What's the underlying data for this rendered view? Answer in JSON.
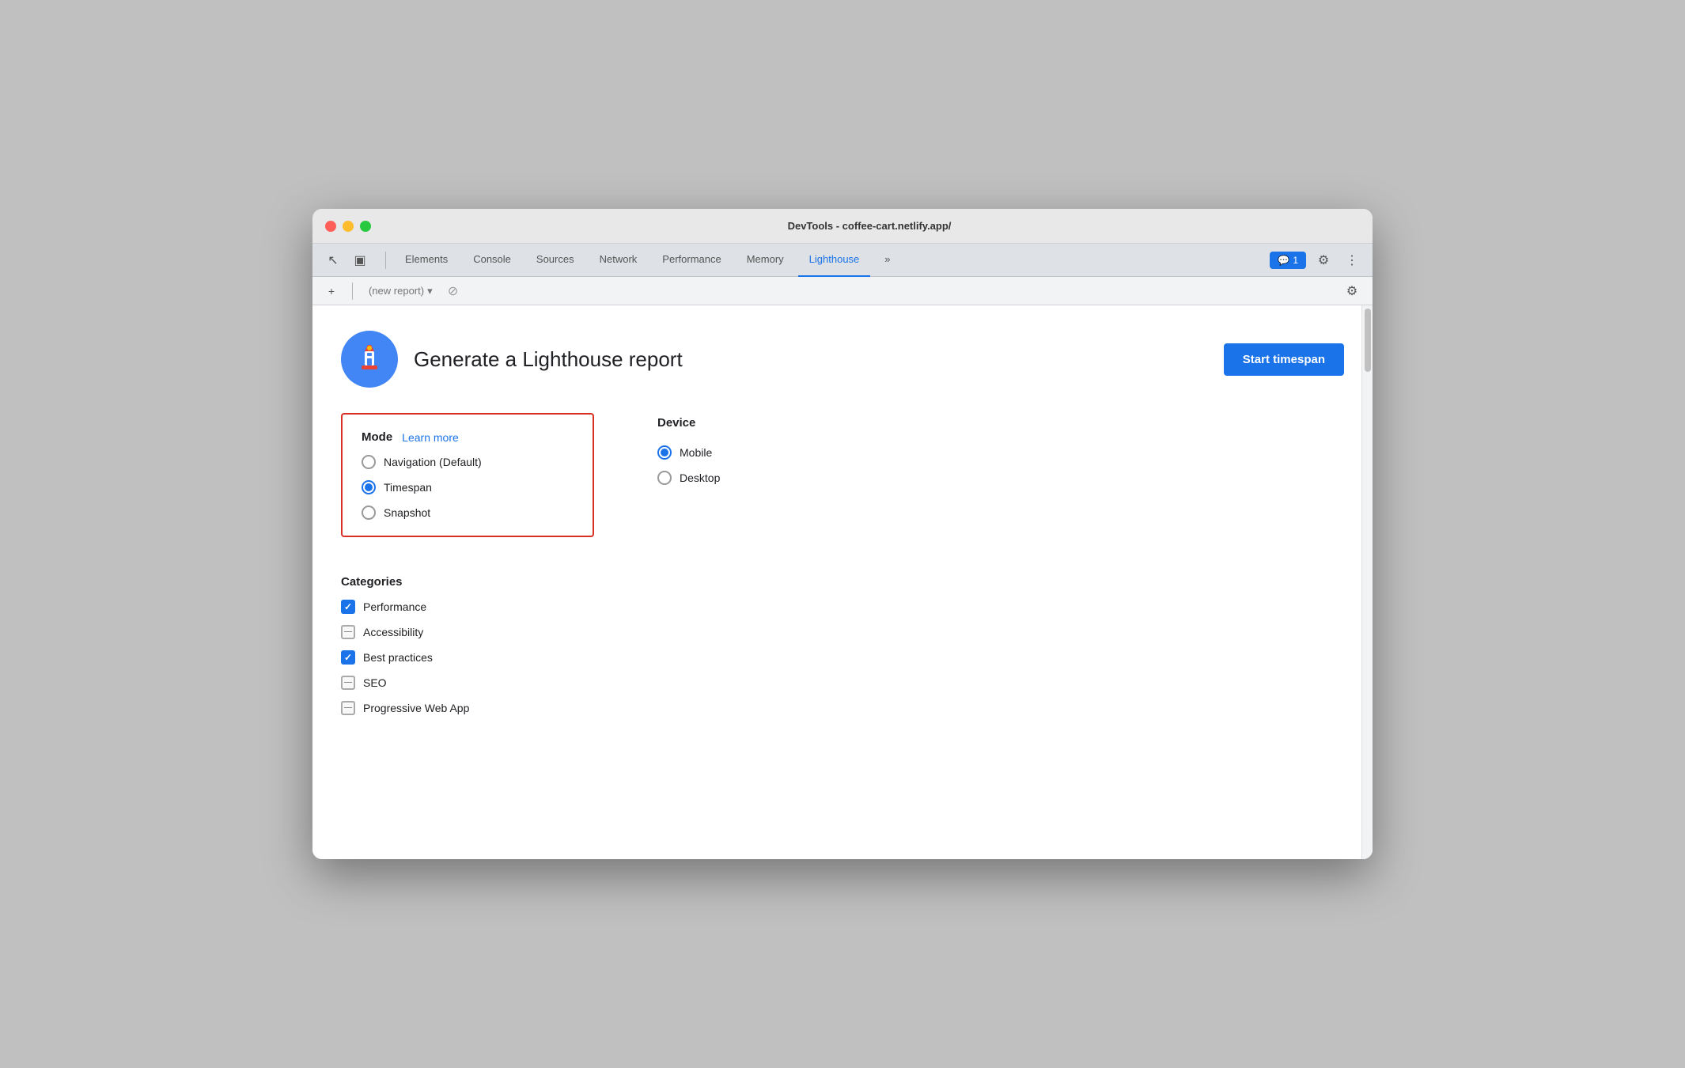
{
  "window": {
    "title": "DevTools - coffee-cart.netlify.app/"
  },
  "traffic_lights": {
    "red": "red",
    "yellow": "yellow",
    "green": "green"
  },
  "tabs": [
    {
      "label": "Elements",
      "active": false
    },
    {
      "label": "Console",
      "active": false
    },
    {
      "label": "Sources",
      "active": false
    },
    {
      "label": "Network",
      "active": false
    },
    {
      "label": "Performance",
      "active": false
    },
    {
      "label": "Memory",
      "active": false
    },
    {
      "label": "Lighthouse",
      "active": true
    }
  ],
  "tab_overflow_label": "»",
  "badge": {
    "icon": "💬",
    "count": "1"
  },
  "sub_toolbar": {
    "add_label": "+",
    "report_placeholder": "(new report)",
    "settings_icon": "⚙"
  },
  "header": {
    "title": "Generate a Lighthouse report",
    "start_button_label": "Start timespan"
  },
  "mode_section": {
    "label": "Mode",
    "learn_more_label": "Learn more",
    "options": [
      {
        "label": "Navigation (Default)",
        "selected": false
      },
      {
        "label": "Timespan",
        "selected": true
      },
      {
        "label": "Snapshot",
        "selected": false
      }
    ]
  },
  "device_section": {
    "label": "Device",
    "options": [
      {
        "label": "Mobile",
        "selected": true
      },
      {
        "label": "Desktop",
        "selected": false
      }
    ]
  },
  "categories_section": {
    "label": "Categories",
    "items": [
      {
        "label": "Performance",
        "state": "checked"
      },
      {
        "label": "Accessibility",
        "state": "indeterminate"
      },
      {
        "label": "Best practices",
        "state": "checked"
      },
      {
        "label": "SEO",
        "state": "indeterminate"
      },
      {
        "label": "Progressive Web App",
        "state": "indeterminate"
      }
    ]
  },
  "icons": {
    "cursor": "↖",
    "layers": "▣",
    "more_tabs": "»",
    "settings": "⚙",
    "more_vert": "⋮",
    "chevron_down": "▾",
    "cancel": "⊘",
    "plus": "+"
  }
}
